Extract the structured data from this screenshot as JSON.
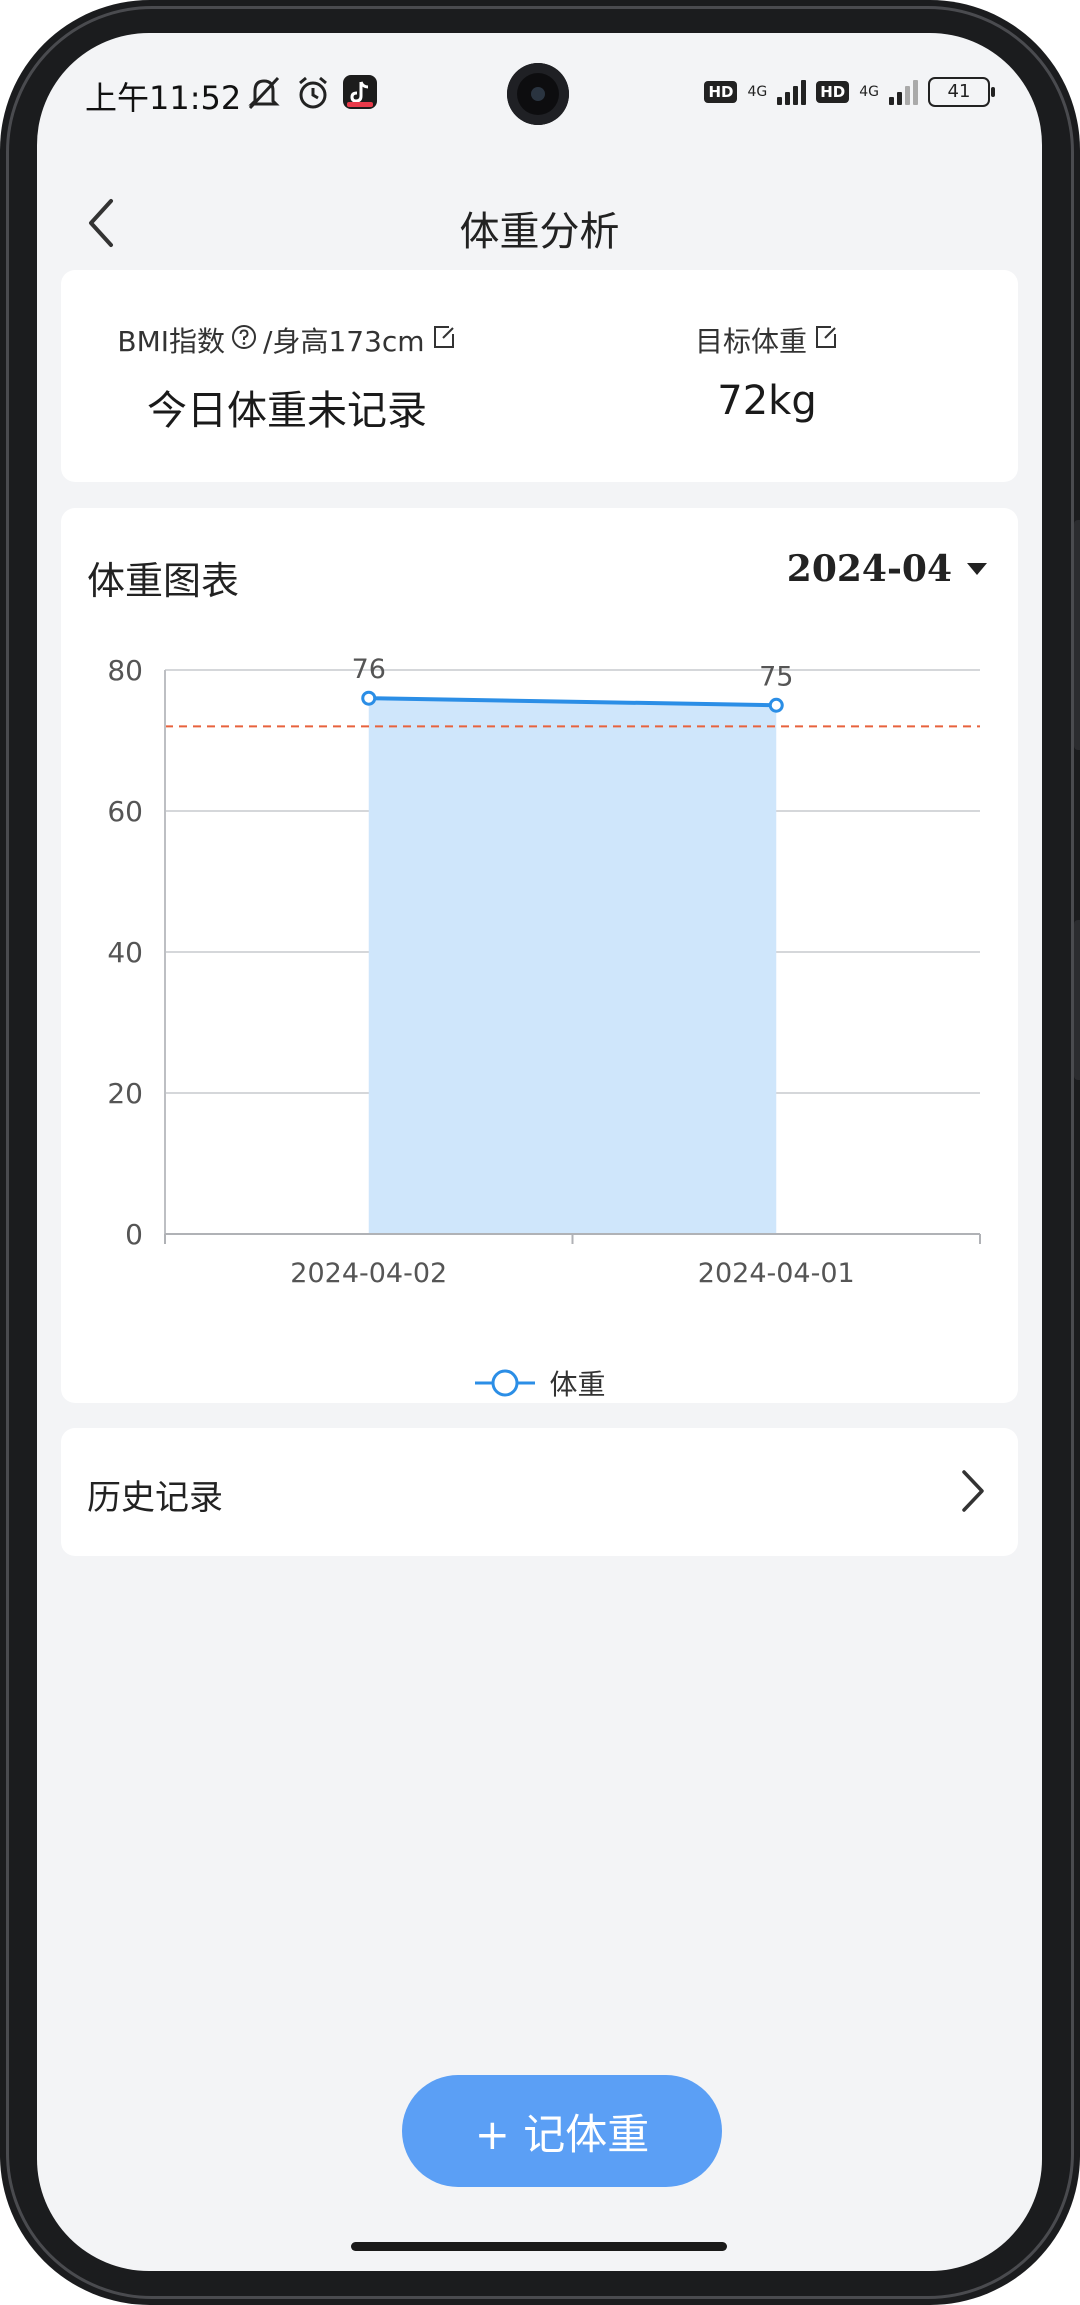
{
  "status_bar": {
    "time": "上午11:52",
    "network_1": "4G",
    "network_2": "4G",
    "hd_1": "HD",
    "hd_2": "HD",
    "battery": "41",
    "icons": [
      "mute-icon",
      "alarm-icon",
      "douyin-app-icon"
    ]
  },
  "header": {
    "title": "体重分析",
    "back_icon": "chevron-left-icon"
  },
  "summary": {
    "bmi_label": "BMI指数",
    "height_label": "/身高173cm",
    "bmi_value": "今日体重未记录",
    "target_label": "目标体重",
    "target_value": "72kg"
  },
  "chart_section": {
    "title": "体重图表",
    "month": "2024-04"
  },
  "chart_data": {
    "type": "line",
    "categories": [
      "2024-04-02",
      "2024-04-01"
    ],
    "series": [
      {
        "name": "体重",
        "values": [
          76,
          75
        ],
        "color": "#2b8ee6",
        "area_color": "#cfe6fb"
      }
    ],
    "ylim": [
      0,
      80
    ],
    "yticks": [
      0,
      20,
      40,
      60,
      80
    ],
    "target_line": {
      "value": 72,
      "color": "#e8623c"
    },
    "grid": true,
    "legend": "bottom-center"
  },
  "history": {
    "label": "历史记录"
  },
  "add_button": {
    "label": "+ 记体重"
  },
  "colors": {
    "background": "#f3f4f6",
    "primary": "#5b9ff5",
    "line": "#2b8ee6",
    "target": "#e8623c"
  }
}
